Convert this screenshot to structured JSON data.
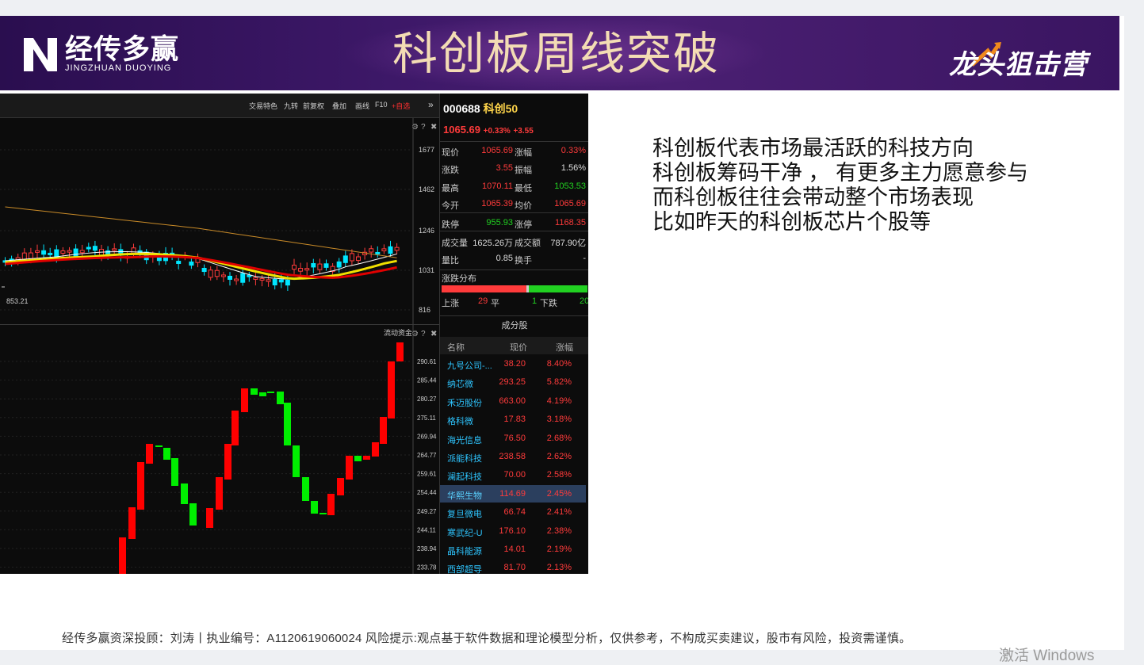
{
  "header": {
    "logo_cn": "经传多赢",
    "logo_en": "JINGZHUAN DUOYING",
    "title": "科创板周线突破",
    "brand": "龙头狙击营"
  },
  "toolbar": {
    "items": [
      "交易特色",
      "九转",
      "前复权",
      "叠加",
      "画线",
      "F10",
      "+自选"
    ],
    "more": "»"
  },
  "chart_top": {
    "y_ticks": [
      "1677",
      "1462",
      "1246",
      "1031",
      "816"
    ],
    "low_label": "853.21"
  },
  "chart_bottom": {
    "label": "流动资金",
    "y_ticks": [
      "290.61",
      "285.44",
      "280.27",
      "275.11",
      "269.94",
      "264.77",
      "259.61",
      "254.44",
      "249.27",
      "244.11",
      "238.94",
      "233.78"
    ]
  },
  "quote": {
    "code": "000688",
    "name": "科创50",
    "price": "1065.69",
    "change_pct": "+0.33%",
    "change": "+3.55",
    "rows": [
      {
        "l1": "现价",
        "v1": "1065.69",
        "c1": "red",
        "l2": "涨幅",
        "v2": "0.33%",
        "c2": "red"
      },
      {
        "l1": "涨跌",
        "v1": "3.55",
        "c1": "red",
        "l2": "振幅",
        "v2": "1.56%",
        "c2": "wht"
      },
      {
        "l1": "最高",
        "v1": "1070.11",
        "c1": "red",
        "l2": "最低",
        "v2": "1053.53",
        "c2": "grn"
      },
      {
        "l1": "今开",
        "v1": "1065.39",
        "c1": "red",
        "l2": "均价",
        "v2": "1065.69",
        "c2": "red"
      },
      {
        "l1": "跌停",
        "v1": "955.93",
        "c1": "grn",
        "l2": "涨停",
        "v2": "1168.35",
        "c2": "red"
      },
      {
        "l1": "成交量",
        "v1": "1625.26万",
        "c1": "wht",
        "l2": "成交额",
        "v2": "787.90亿",
        "c2": "wht"
      },
      {
        "l1": "量比",
        "v1": "0.85",
        "c1": "wht",
        "l2": "换手",
        "v2": "-",
        "c2": "wht"
      }
    ],
    "dist_title": "涨跌分布",
    "up_label": "上涨",
    "up_count": "29",
    "flat_label": "平",
    "flat_count": "1",
    "down_label": "下跌",
    "down_count": "20",
    "up_share": 0.58,
    "flat_share": 0.02,
    "down_share": 0.4
  },
  "constituents": {
    "title": "成分股",
    "headers": [
      "名称",
      "现价",
      "涨幅"
    ],
    "rows": [
      {
        "name": "九号公司-...",
        "price": "38.20",
        "pct": "8.40%"
      },
      {
        "name": "纳芯微",
        "price": "293.25",
        "pct": "5.82%"
      },
      {
        "name": "禾迈股份",
        "price": "663.00",
        "pct": "4.19%"
      },
      {
        "name": "格科微",
        "price": "17.83",
        "pct": "3.18%"
      },
      {
        "name": "海光信息",
        "price": "76.50",
        "pct": "2.68%"
      },
      {
        "name": "派能科技",
        "price": "238.58",
        "pct": "2.62%"
      },
      {
        "name": "澜起科技",
        "price": "70.00",
        "pct": "2.58%"
      },
      {
        "name": "华熙生物",
        "price": "114.69",
        "pct": "2.45%"
      },
      {
        "name": "复旦微电",
        "price": "66.74",
        "pct": "2.41%"
      },
      {
        "name": "寒武纪-U",
        "price": "176.10",
        "pct": "2.38%"
      },
      {
        "name": "晶科能源",
        "price": "14.01",
        "pct": "2.19%"
      },
      {
        "name": "西部超导",
        "price": "81.70",
        "pct": "2.13%"
      }
    ]
  },
  "commentary": [
    "科创板代表市场最活跃的科技方向",
    "科创板筹码干净 ， 有更多主力愿意参与",
    "而科创板往往会带动整个市场表现",
    "比如昨天的科创板芯片个股等"
  ],
  "footer": "经传多赢资深投顾：刘涛丨执业编号：A1120619060024   风险提示:观点基于软件数据和理论模型分析，仅供参考，不构成买卖建议，股市有风险，投资需谨慎。",
  "watermark": "激活 Windows",
  "colors": {
    "banner": "#3d1868",
    "title": "#f3dcb4",
    "up": "#ff3b3b",
    "down": "#21d121",
    "ma_red": "#e00000",
    "ma_yellow": "#f0e000",
    "ma_orange": "#c88a28"
  }
}
